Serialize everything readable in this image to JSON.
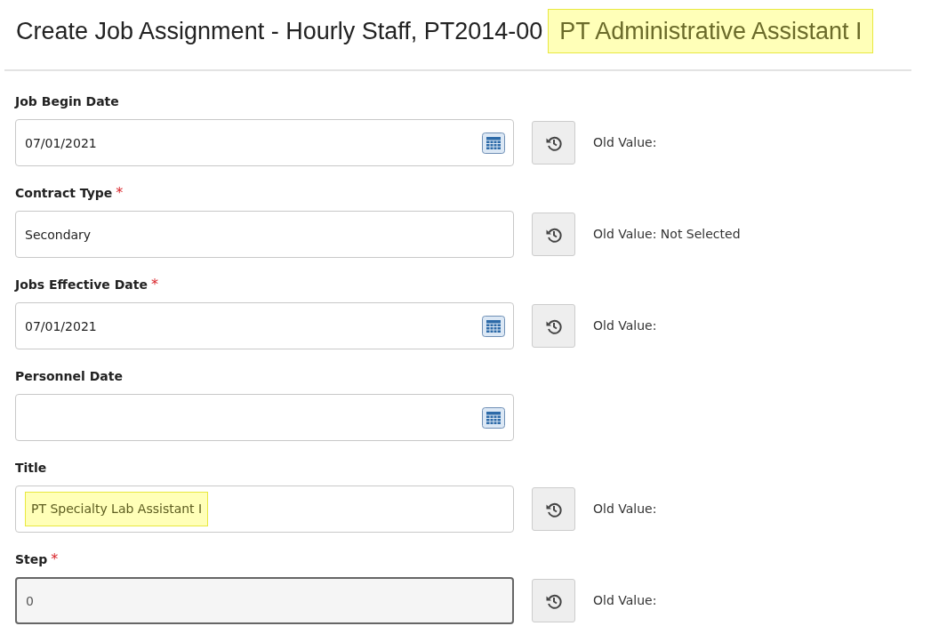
{
  "header": {
    "title": "Create Job Assignment - Hourly Staff, PT2014-00",
    "highlight": "PT Administrative Assistant I"
  },
  "fields": [
    {
      "label": "Job Begin Date",
      "value": "07/01/2021",
      "calendar": true,
      "history": true,
      "old_value": "Old Value:"
    },
    {
      "label": "Contract Type",
      "required_mark": "*",
      "value": "Secondary",
      "history": true,
      "old_value": "Old Value: Not Selected"
    },
    {
      "label": "Jobs Effective Date",
      "required_mark": "*",
      "value": "07/01/2021",
      "calendar": true,
      "history": true,
      "old_value": "Old Value:"
    },
    {
      "label": "Personnel Date",
      "calendar": true
    },
    {
      "label": "Title",
      "value": "PT Specialty Lab Assistant I",
      "history": true,
      "old_value": "Old Value:",
      "highlighted": true
    },
    {
      "label": "Step",
      "required_mark": "*",
      "value": "0",
      "history": true,
      "old_value": "Old Value:",
      "disabled": true
    }
  ]
}
